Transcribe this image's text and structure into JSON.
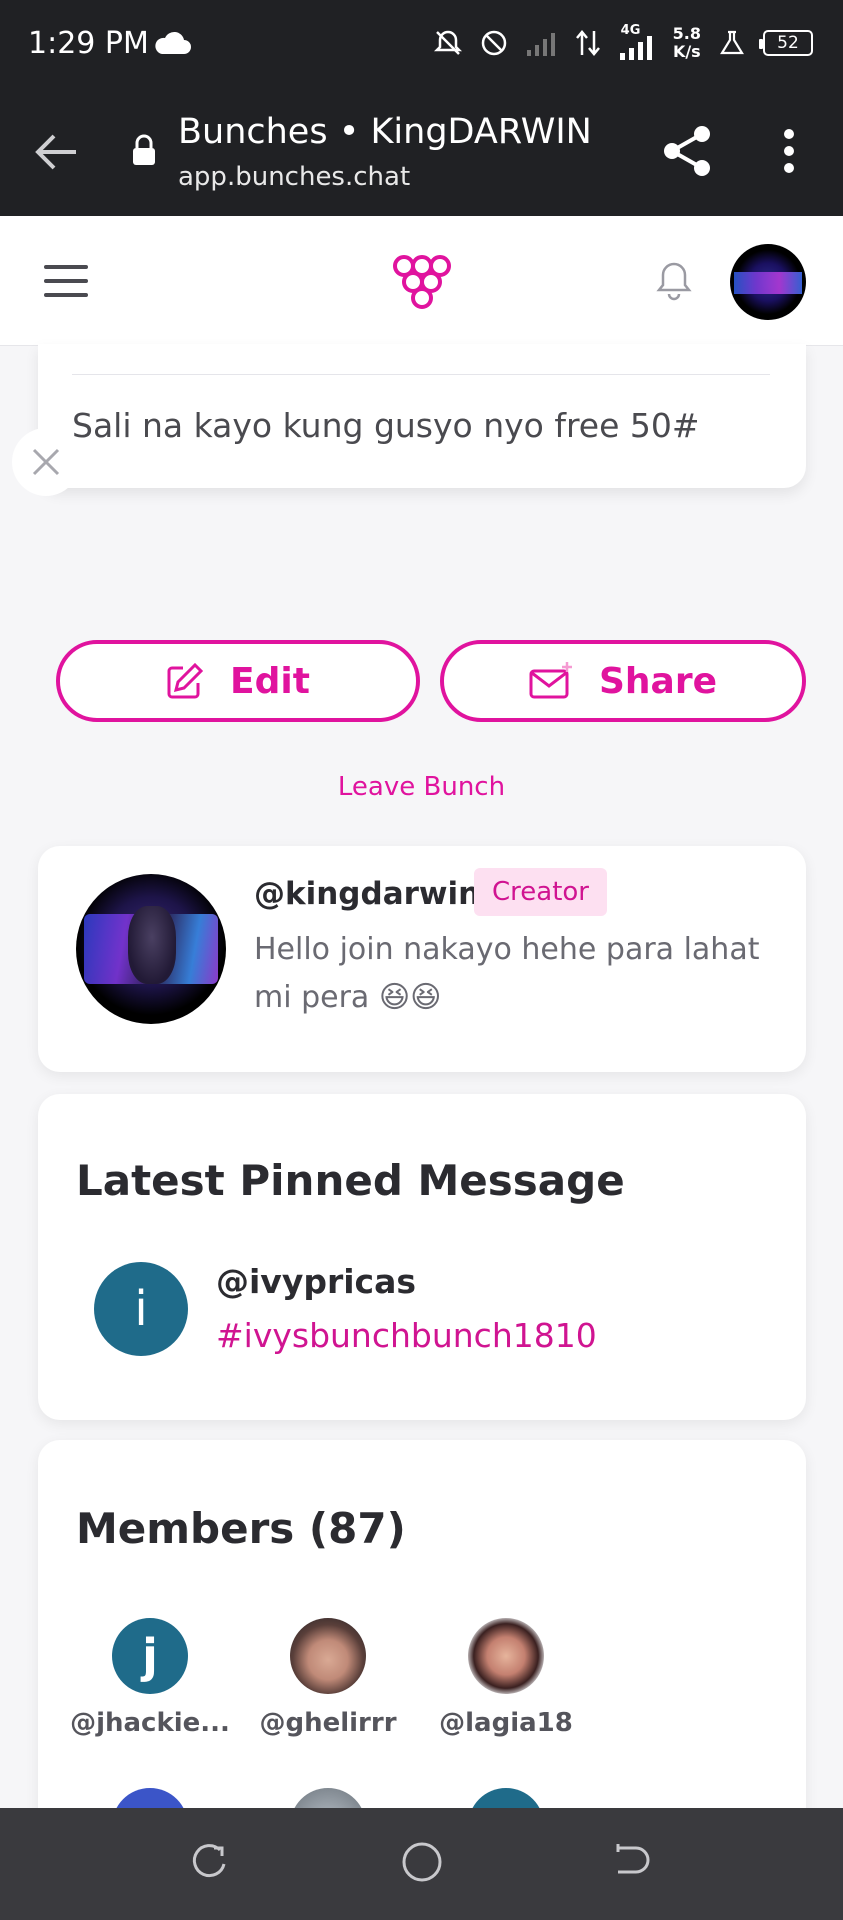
{
  "status_bar": {
    "time": "1:29 PM",
    "net_speed_value": "5.8",
    "net_speed_unit": "K/s",
    "network": "4G",
    "battery": "52"
  },
  "browser": {
    "title": "Bunches • KingDARWIN",
    "url": "app.bunches.chat"
  },
  "message": {
    "text": "Sali na kayo kung gusyo nyo free 50#"
  },
  "actions": {
    "edit_label": "Edit",
    "share_label": "Share",
    "leave_label": "Leave Bunch"
  },
  "creator": {
    "handle": "@kingdarwin",
    "badge": "Creator",
    "bio": "Hello join nakayo hehe para lahat mi pera 😆😆"
  },
  "pinned": {
    "title": "Latest Pinned Message",
    "avatar_letter": "i",
    "handle": "@ivypricas",
    "tag": "#ivysbunchbunch1810"
  },
  "members": {
    "title": "Members (87)",
    "items": [
      {
        "letter": "j",
        "name": "@jhackie..."
      },
      {
        "letter": "",
        "name": "@ghelirrr"
      },
      {
        "letter": "",
        "name": "@lagia18"
      }
    ]
  },
  "colors": {
    "accent": "#e0139e",
    "dark_bar": "#202124",
    "avatar_teal": "#1f6b8a"
  }
}
